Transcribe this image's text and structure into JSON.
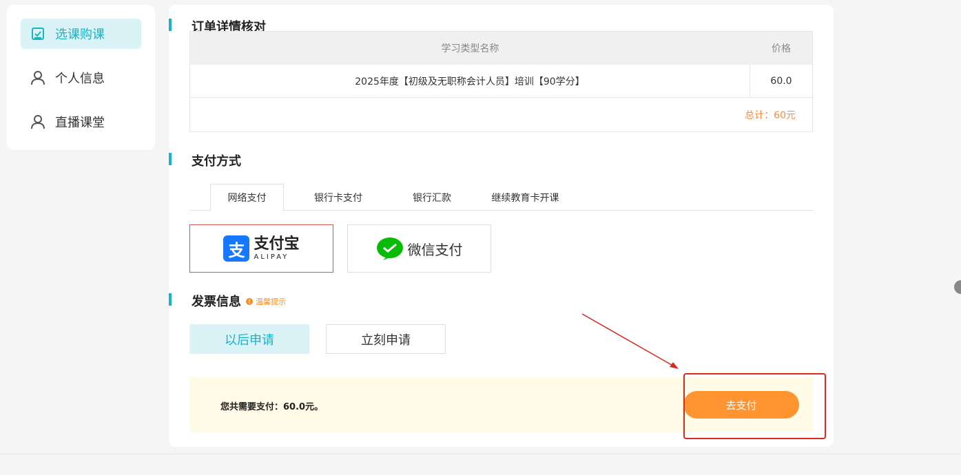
{
  "sidebar": {
    "items": [
      {
        "label": "选课购课",
        "icon": "checkbox-icon",
        "active": true
      },
      {
        "label": "个人信息",
        "icon": "person-icon",
        "active": false
      },
      {
        "label": "直播课堂",
        "icon": "person-icon",
        "active": false
      }
    ]
  },
  "order": {
    "title": "订单详情核对",
    "columns": [
      "学习类型名称",
      "价格"
    ],
    "rows": [
      {
        "name": "2025年度【初级及无职称会计人员】培训【90学分】",
        "price": "60.0"
      }
    ],
    "total": "总计：60元"
  },
  "payment": {
    "title": "支付方式",
    "tabs": [
      "网络支付",
      "银行卡支付",
      "银行汇款",
      "继续教育卡开课"
    ],
    "active_tab": "网络支付",
    "options": [
      {
        "name_cn": "支付宝",
        "name_en": "ALIPAY",
        "selected": true
      },
      {
        "name_cn": "微信支付",
        "selected": false
      }
    ]
  },
  "invoice": {
    "title": "发票信息",
    "tip": "温馨提示",
    "buttons": [
      "以后申请",
      "立刻申请"
    ],
    "selected": "以后申请"
  },
  "checkout": {
    "summary": "您共需要支付：60.0元。",
    "pay_button": "去支付"
  },
  "colors": {
    "accent": "#1bb2c4",
    "orange": "#ff9431",
    "highlight": "#d9291c",
    "alipay": "#1677ff",
    "wechat": "#09bb07"
  }
}
